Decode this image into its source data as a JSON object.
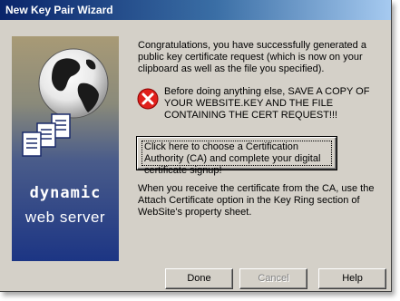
{
  "window": {
    "title": "New Key Pair Wizard"
  },
  "banner": {
    "brand_line1": "dynamic",
    "brand_line2": "web server"
  },
  "content": {
    "congrats": "Congratulations, you have successfully generated a public key certificate request (which is now on your clipboard as well as the file you specified).",
    "warning_icon": "error-x-icon",
    "warning": "Before doing anything else, SAVE A COPY OF YOUR WEBSITE.KEY AND THE FILE CONTAINING THE CERT REQUEST!!!",
    "ca_button_label": "Click here to choose a Certification Authority (CA) and complete your digital certificate signup!",
    "receive": "When you receive the certificate from the CA, use the Attach Certificate option in the Key Ring section of WebSite's property sheet."
  },
  "buttons": {
    "done": "Done",
    "cancel": "Cancel",
    "help": "Help"
  },
  "colors": {
    "titlebar_start": "#0a246a",
    "titlebar_end": "#a6caf0",
    "dialog_face": "#d4d0c8",
    "error_red": "#e0201c"
  }
}
